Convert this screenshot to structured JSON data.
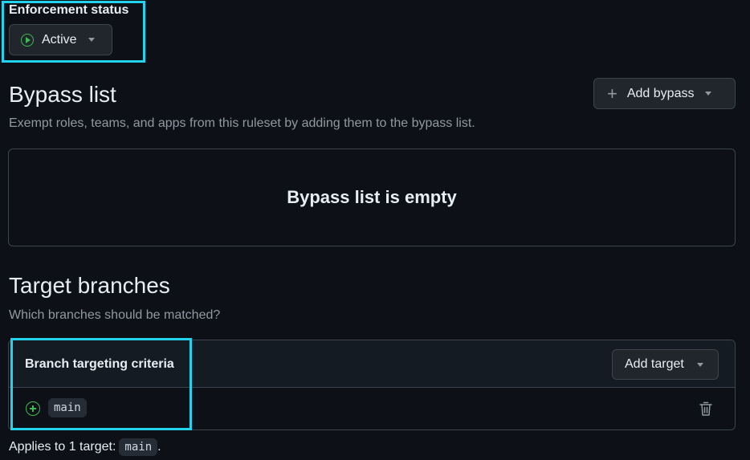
{
  "enforcement": {
    "label": "Enforcement status",
    "value": "Active",
    "icon": "play-circle-icon"
  },
  "bypass": {
    "title": "Bypass list",
    "description": "Exempt roles, teams, and apps from this ruleset by adding them to the bypass list.",
    "add_label": "Add bypass",
    "empty_text": "Bypass list is empty"
  },
  "targets": {
    "title": "Target branches",
    "description": "Which branches should be matched?",
    "criteria_label": "Branch targeting criteria",
    "add_label": "Add target",
    "items": [
      {
        "pattern": "main",
        "icon": "plus-circle-icon"
      }
    ],
    "applies_prefix": "Applies to 1 target:",
    "applies_target": "main",
    "applies_suffix": "."
  },
  "colors": {
    "background": "#0d1117",
    "accent_highlight": "#22d3ee",
    "success": "#3fb950"
  }
}
